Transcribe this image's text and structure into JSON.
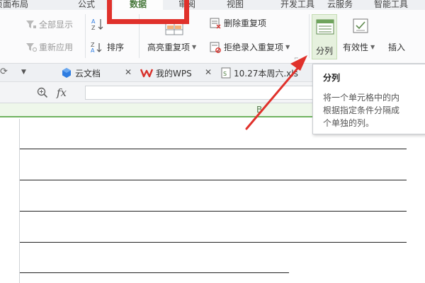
{
  "menu": {
    "tabs": [
      "页面布局",
      "公式",
      "数据",
      "审阅",
      "视图",
      "开发工具",
      "云服务",
      "智能工具"
    ],
    "active_index": 2
  },
  "ribbon": {
    "show_all": "全部显示",
    "reapply": "重新应用",
    "sort": "排序",
    "highlight_dup": "高亮重复项",
    "delete_dup": "删除重复项",
    "reject_dup": "拒绝录入重复项",
    "split": "分列",
    "validity": "有效性",
    "insert": "插入"
  },
  "doctabs": {
    "cloud": "云文档",
    "wps": "我的WPS",
    "file": "10.27本周六.xls"
  },
  "formula": {
    "fx_label": "fx",
    "value": ""
  },
  "sheet": {
    "column": "B"
  },
  "tooltip": {
    "title": "分列",
    "lines": [
      "将一个单元格中的内",
      "根据指定条件分隔成",
      "个单独的列。"
    ]
  },
  "colors": {
    "accent_green": "#4a7a3e",
    "highlight_red": "#e0312b",
    "wps_red": "#d8312b",
    "cloud_blue": "#2f7de1"
  }
}
